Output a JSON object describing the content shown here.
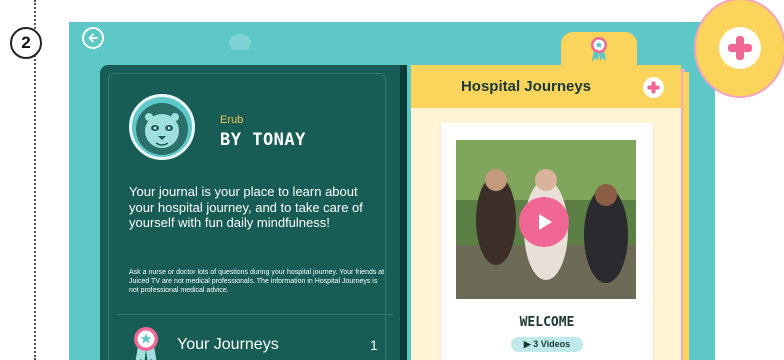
{
  "step": {
    "number": "2"
  },
  "nav": {
    "back_icon": "arrow-left-icon"
  },
  "profile": {
    "small_name": "Erub",
    "byline": "BY TONAY",
    "avatar_icon": "lion-avatar-icon"
  },
  "intro_text": "Your journal is your place to learn about your hospital journey, and to take care of yourself with fun daily mindfulness!",
  "disclaimer_text": "Ask a nurse or doctor lots of questions during your hospital journey. Your friends at Juiced TV are not medical professionals. The information in Hospital Journeys is not professional medical advice.",
  "journeys": {
    "label": "Your Journeys",
    "count": "1",
    "badge_icon": "ribbon-badge-icon"
  },
  "right_page": {
    "title": "Hospital Journeys",
    "add_icon": "plus-icon",
    "tab_icon": "ribbon-badge-icon",
    "card": {
      "title": "WELCOME",
      "videos_label": "▶ 3 Videos",
      "play_icon": "play-icon"
    }
  },
  "callout": {
    "add_icon": "plus-icon"
  },
  "colors": {
    "teal_bg": "#5ec7c8",
    "dark_green": "#175d55",
    "yellow": "#fbd45b",
    "pink": "#f06795",
    "cream": "#fff5d5"
  }
}
